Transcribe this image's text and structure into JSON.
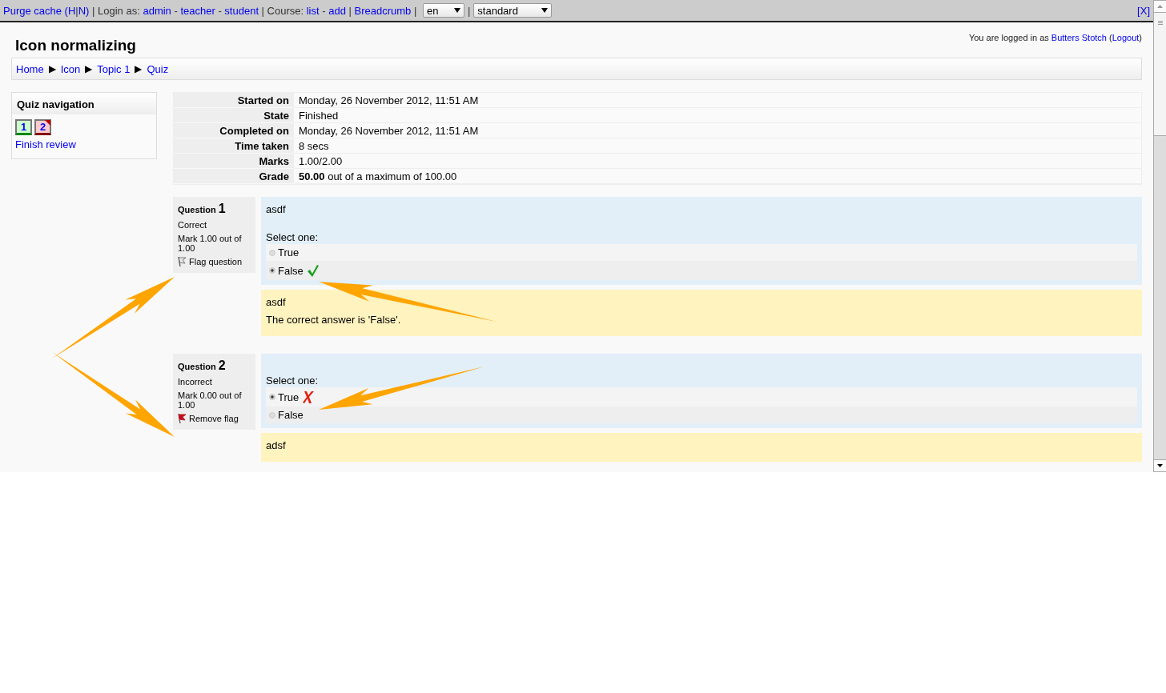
{
  "topbar": {
    "segments": [
      {
        "kind": "link",
        "text": "Purge cache (H"
      },
      {
        "kind": "text",
        "text": "|"
      },
      {
        "kind": "link",
        "text": "N)"
      },
      {
        "kind": "text",
        "text": " | Login as: "
      },
      {
        "kind": "link",
        "text": "admin"
      },
      {
        "kind": "text",
        "text": " - "
      },
      {
        "kind": "link",
        "text": "teacher"
      },
      {
        "kind": "text",
        "text": " - "
      },
      {
        "kind": "link",
        "text": "student"
      },
      {
        "kind": "text",
        "text": " | Course: "
      },
      {
        "kind": "link",
        "text": "list"
      },
      {
        "kind": "text",
        "text": " - "
      },
      {
        "kind": "link",
        "text": "add"
      },
      {
        "kind": "text",
        "text": " | "
      },
      {
        "kind": "link",
        "text": "Breadcrumb"
      },
      {
        "kind": "text",
        "text": " | "
      }
    ],
    "selects": [
      {
        "value": "en"
      },
      {
        "value": "standard"
      }
    ],
    "separator": "|",
    "close": "[X]"
  },
  "header": {
    "title": "Icon normalizing",
    "login_text": "You are logged in as ",
    "user": "Butters Stotch",
    "logout_open": " (",
    "logout": "Logout",
    "logout_close": ")"
  },
  "breadcrumb": {
    "separator": "▶",
    "items": [
      "Home",
      "Icon",
      "Topic 1",
      "Quiz"
    ]
  },
  "quiz_navigation": {
    "title": "Quiz navigation",
    "buttons": [
      {
        "label": "1",
        "correct": true,
        "flagged": false
      },
      {
        "label": "2",
        "correct": false,
        "flagged": true
      }
    ],
    "finish": "Finish review"
  },
  "summary": [
    {
      "label": "Started on",
      "value": "Monday, 26 November 2012, 11:51 AM"
    },
    {
      "label": "State",
      "value": "Finished"
    },
    {
      "label": "Completed on",
      "value": "Monday, 26 November 2012, 11:51 AM"
    },
    {
      "label": "Time taken",
      "value": "8 secs"
    },
    {
      "label": "Marks",
      "value": "1.00/2.00"
    },
    {
      "label": "Grade",
      "value": "**50.00** out of a maximum of 100.00"
    }
  ],
  "questions": [
    {
      "word": "Question",
      "number": "1",
      "status": "Correct",
      "mark": "Mark 1.00 out of 1.00",
      "flag": {
        "label": "Flag question",
        "flagged": false
      },
      "text": "asdf",
      "prompt": "Select one:",
      "options": [
        {
          "label": "True",
          "selected": false
        },
        {
          "label": "False",
          "selected": true,
          "correct": true
        }
      ],
      "feedback": [
        "asdf",
        "The correct answer is 'False'."
      ]
    },
    {
      "word": "Question",
      "number": "2",
      "status": "Incorrect",
      "mark": "Mark 0.00 out of 1.00",
      "flag": {
        "label": "Remove flag",
        "flagged": true
      },
      "prompt": "Select one:",
      "options": [
        {
          "label": "True",
          "selected": true,
          "correct": false
        },
        {
          "label": "False",
          "selected": false
        }
      ],
      "feedback": [
        "adsf"
      ]
    }
  ]
}
